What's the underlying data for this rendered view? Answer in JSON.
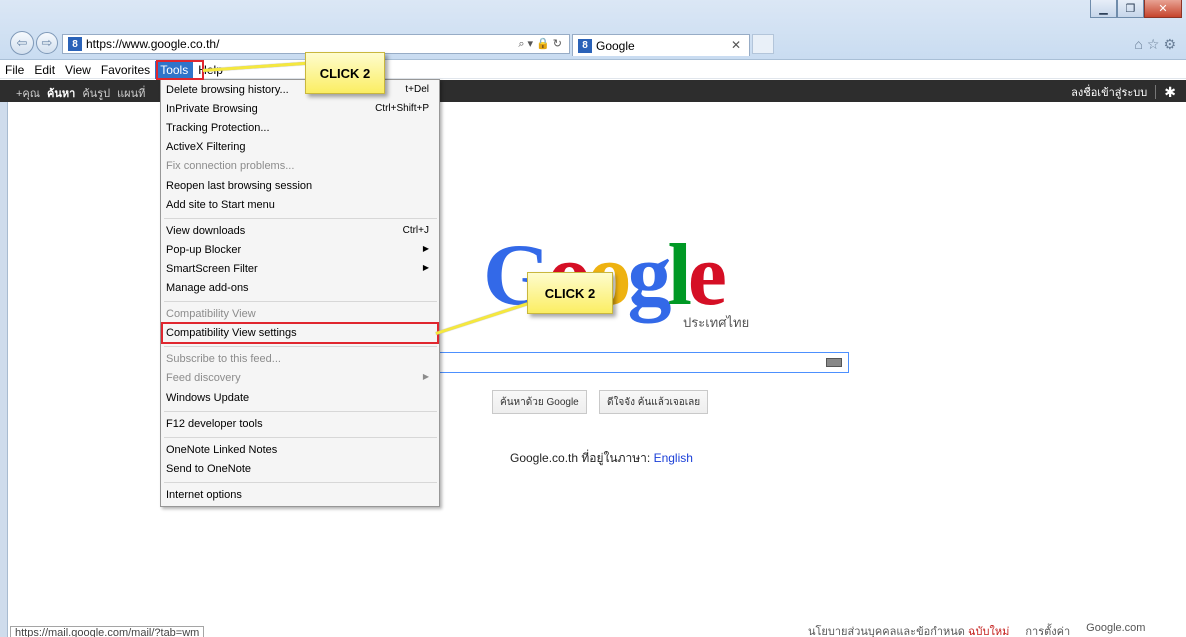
{
  "browser": {
    "address": "https://www.google.co.th/",
    "tab_title": "Google",
    "favicon_letter": "8",
    "menu": [
      "File",
      "Edit",
      "View",
      "Favorites",
      "Tools",
      "Help"
    ]
  },
  "gbar": {
    "left_items": [
      "+คุณ",
      "ค้นหา",
      "ค้นรูป",
      "แผนที่"
    ],
    "signin": "ลงชื่อเข้าสู่ระบบ"
  },
  "tools_menu": {
    "groups": [
      [
        {
          "label": "Delete browsing history...",
          "shortcut": "t+Del"
        },
        {
          "label": "InPrivate Browsing",
          "shortcut": "Ctrl+Shift+P"
        },
        {
          "label": "Tracking Protection..."
        },
        {
          "label": "ActiveX Filtering"
        },
        {
          "label": "Fix connection problems...",
          "disabled": true
        },
        {
          "label": "Reopen last browsing session"
        },
        {
          "label": "Add site to Start menu"
        }
      ],
      [
        {
          "label": "View downloads",
          "shortcut": "Ctrl+J"
        },
        {
          "label": "Pop-up Blocker",
          "submenu": true
        },
        {
          "label": "SmartScreen Filter",
          "submenu": true
        },
        {
          "label": "Manage add-ons"
        }
      ],
      [
        {
          "label": "Compatibility View",
          "disabled": true
        },
        {
          "label": "Compatibility View settings"
        }
      ],
      [
        {
          "label": "Subscribe to this feed...",
          "disabled": true
        },
        {
          "label": "Feed discovery",
          "disabled": true,
          "submenu": true
        },
        {
          "label": "Windows Update"
        }
      ],
      [
        {
          "label": "F12 developer tools"
        }
      ],
      [
        {
          "label": "OneNote Linked Notes"
        },
        {
          "label": "Send to OneNote"
        }
      ],
      [
        {
          "label": "Internet options"
        }
      ]
    ]
  },
  "callouts": {
    "first": "CLICK 2",
    "second": "CLICK 2"
  },
  "google": {
    "logo_letters": [
      "G",
      "o",
      "o",
      "g",
      "l",
      "e"
    ],
    "logo_colors": [
      "#3369e8",
      "#d50f25",
      "#eeb211",
      "#3369e8",
      "#009925",
      "#d50f25"
    ],
    "subbrand": "ประเทศไทย",
    "search_button": "ค้นหาด้วย Google",
    "lucky_button": "ดีใจจัง ค้นแล้วเจอเลย",
    "lang_text": "Google.co.th ที่อยู่ในภาษา:",
    "lang_link": "English",
    "footer": [
      "นโยบายส่วนบุคคลและข้อกำหนด",
      "ฉบับใหม่",
      "การตั้งค่า",
      "Google.com"
    ]
  },
  "status_url": "https://mail.google.com/mail/?tab=wm"
}
